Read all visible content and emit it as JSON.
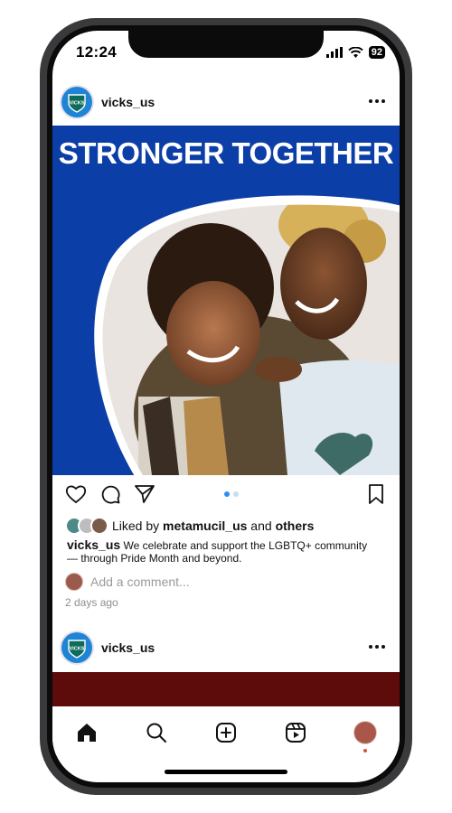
{
  "status_bar": {
    "time": "12:24",
    "battery": "92"
  },
  "post1": {
    "username": "vicks_us",
    "avatar_text": "VICKS",
    "headline": "STRONGER TOGETHER",
    "liked_prefix": "Liked by ",
    "liked_user": "metamucil_us",
    "liked_and": " and ",
    "liked_others": "others",
    "caption_user": "vicks_us",
    "caption_text": "We celebrate and support the LGBTQ+ community — through Pride Month and beyond.",
    "comment_placeholder": "Add a comment...",
    "time_ago": "2 days ago",
    "carousel_dots": 2,
    "brand_color": "#0c3ea7"
  },
  "post2": {
    "username": "vicks_us",
    "avatar_text": "VICKS"
  },
  "nav": {
    "items": [
      "home-icon",
      "search-icon",
      "create-icon",
      "reels-icon",
      "profile-avatar"
    ]
  }
}
